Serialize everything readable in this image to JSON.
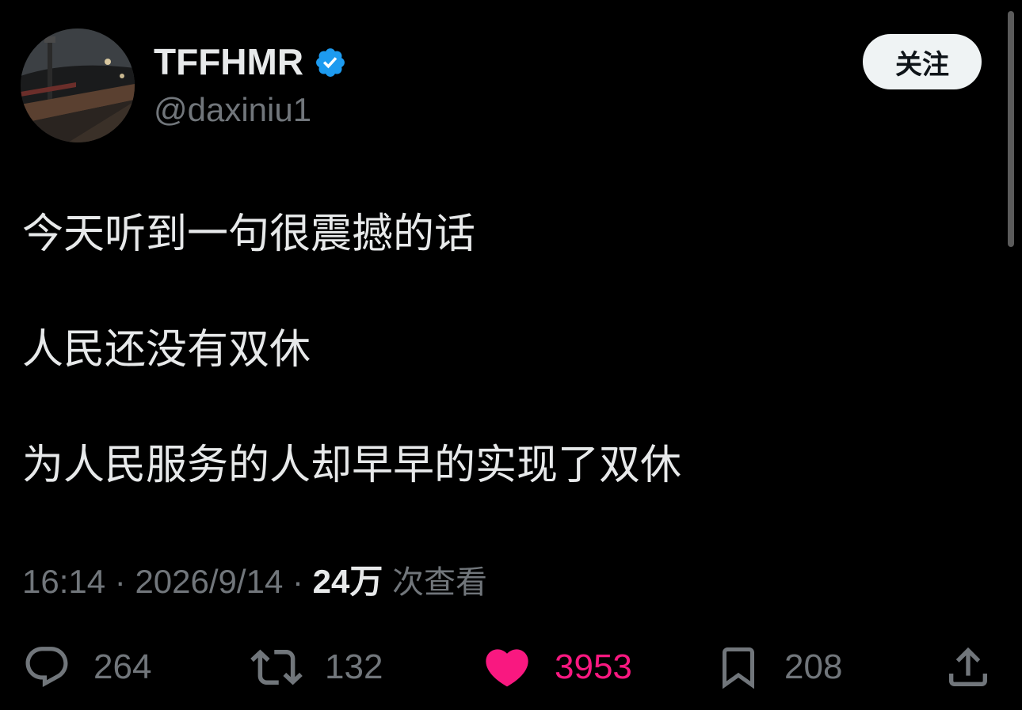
{
  "author": {
    "display_name": "TFFHMR",
    "handle": "@daxiniu1",
    "verified": true,
    "avatar": "avatar-image"
  },
  "follow_label": "关注",
  "tweet": {
    "lines": [
      "今天听到一句很震撼的话",
      "人民还没有双休",
      "为人民服务的人却早早的实现了双休"
    ]
  },
  "meta": {
    "time": "16:14",
    "separator": "·",
    "date": "2026/9/14",
    "views_count": "24万",
    "views_label": "次查看"
  },
  "actions": {
    "reply": {
      "icon": "reply-icon",
      "count": "264"
    },
    "retweet": {
      "icon": "retweet-icon",
      "count": "132"
    },
    "like": {
      "icon": "heart-icon",
      "count": "3953",
      "active": true
    },
    "bookmark": {
      "icon": "bookmark-icon",
      "count": "208"
    },
    "share": {
      "icon": "share-icon"
    }
  },
  "colors": {
    "background": "#000000",
    "primary_text": "#e7e9ea",
    "secondary_text": "#71767b",
    "like_active": "#f91880",
    "verified": "#1d9bf0",
    "follow_bg": "#eff3f4"
  }
}
